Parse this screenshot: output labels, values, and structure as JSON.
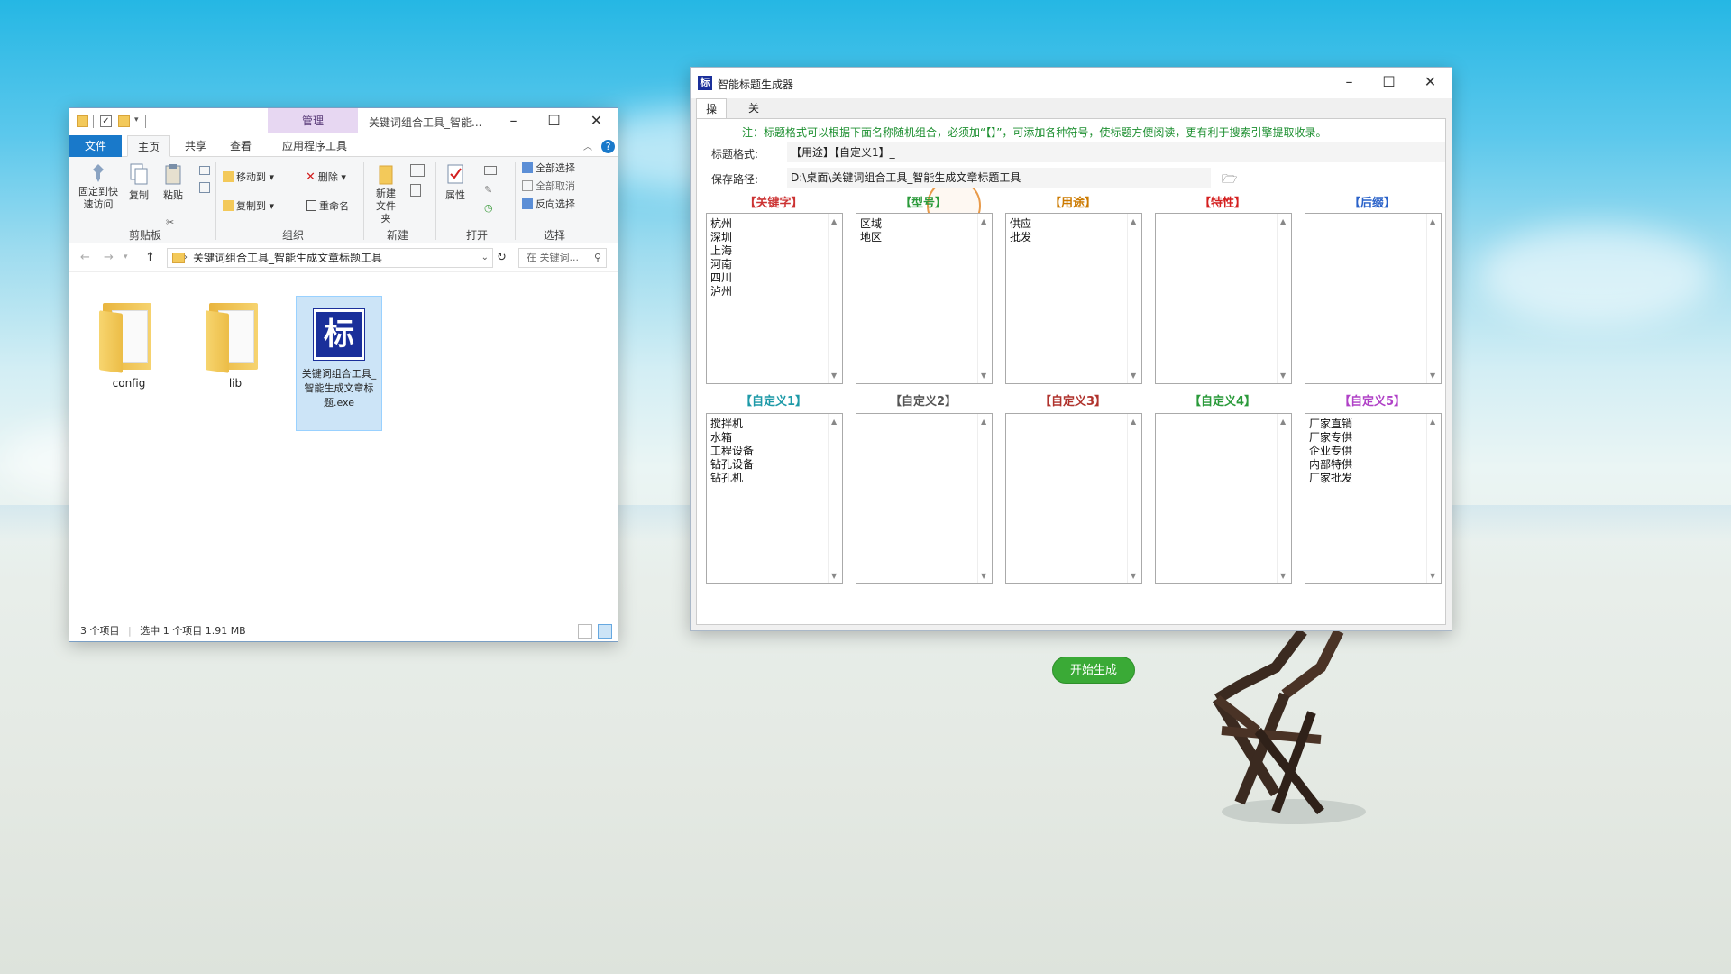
{
  "explorer": {
    "title": "关键词组合工具_智能...",
    "context_tab": "管理",
    "ribbon_tabs": [
      "文件",
      "主页",
      "共享",
      "查看",
      "应用程序工具"
    ],
    "ribbon": {
      "pin_label": "固定到快速访问",
      "copy_label": "复制",
      "paste_label": "粘贴",
      "move_to": "移动到",
      "copy_to": "复制到",
      "delete": "删除",
      "rename": "重命名",
      "new_folder": "新建文件夹",
      "properties": "属性",
      "select_all": "全部选择",
      "select_none": "全部取消",
      "invert_select": "反向选择",
      "groups": [
        "剪贴板",
        "组织",
        "新建",
        "打开",
        "选择"
      ]
    },
    "address": "关键词组合工具_智能生成文章标题工具",
    "search_placeholder": "在 关键词...",
    "files": [
      {
        "name": "config"
      },
      {
        "name": "lib"
      },
      {
        "name": "关键词组合工具_智能生成文章标题.exe"
      }
    ],
    "status": {
      "count": "3 个项目",
      "selected": "选中 1 个项目  1.91 MB"
    }
  },
  "tool": {
    "title": "智能标题生成器",
    "tabs": [
      "操作",
      "关于"
    ],
    "note": "注：标题格式可以根据下面名称随机组合，必须加“【】”，可添加各种符号，使标题方便阅读，更有利于搜索引擎提取收录。",
    "format_label": "标题格式:",
    "format_value": "【用途】【自定义1】_",
    "path_label": "保存路径:",
    "path_value": "D:\\桌面\\关键词组合工具_智能生成文章标题工具",
    "generate_label": "开始生成",
    "columns_row1": [
      {
        "header": "【关键字】",
        "color": "#cc3333",
        "items": [
          "杭州",
          "深圳",
          "上海",
          "河南",
          "四川",
          "泸州"
        ]
      },
      {
        "header": "【型号】",
        "color": "#2a9a3a",
        "items": [
          "区域",
          "地区"
        ]
      },
      {
        "header": "【用途】",
        "color": "#cc7a00",
        "items": [
          "供应",
          "批发"
        ]
      },
      {
        "header": "【特性】",
        "color": "#d42020",
        "items": []
      },
      {
        "header": "【后缀】",
        "color": "#2a62c9",
        "items": []
      }
    ],
    "columns_row2": [
      {
        "header": "【自定义1】",
        "color": "#1e9aa8",
        "items": [
          "搅拌机",
          "水箱",
          "工程设备",
          "钻孔设备",
          "钻孔机"
        ]
      },
      {
        "header": "【自定义2】",
        "color": "#555555",
        "items": []
      },
      {
        "header": "【自定义3】",
        "color": "#b0332d",
        "items": []
      },
      {
        "header": "【自定义4】",
        "color": "#2a9a3a",
        "items": []
      },
      {
        "header": "【自定义5】",
        "color": "#b041c7",
        "items": [
          "厂家直销",
          "厂家专供",
          "企业专供",
          "内部特供",
          "厂家批发"
        ]
      }
    ]
  },
  "colors": {
    "accent": "#1979ca",
    "generate": "#3aaa36",
    "note": "#1d8f30"
  }
}
